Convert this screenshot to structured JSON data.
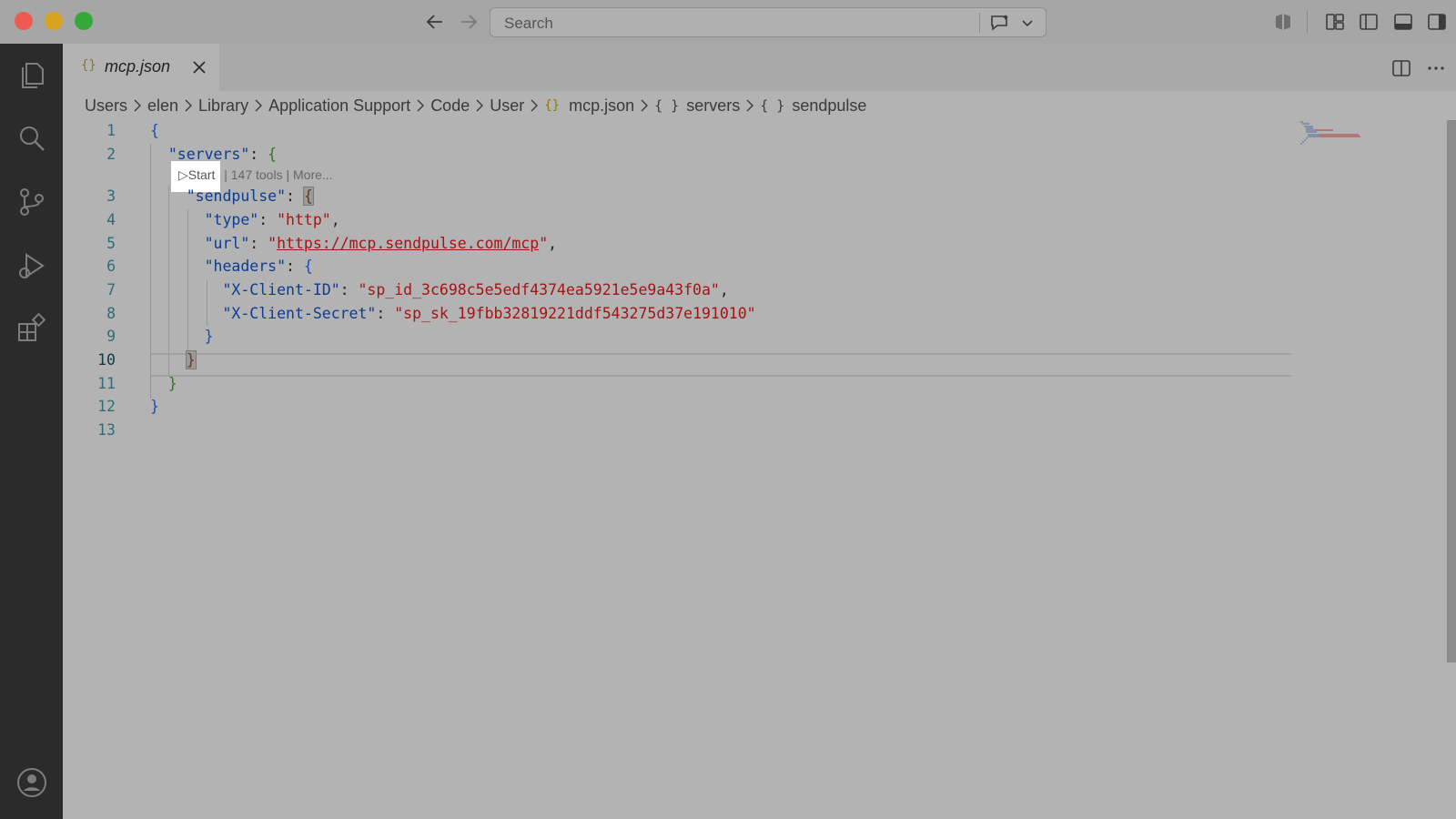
{
  "titlebar": {
    "search_placeholder": "Search",
    "icons": [
      "back-arrow-icon",
      "forward-arrow-icon",
      "chat-icon",
      "chevron-down-icon",
      "copilot-icon",
      "customize-layout-icon",
      "toggle-primary-sidebar-icon",
      "toggle-panel-icon",
      "toggle-secondary-sidebar-icon"
    ]
  },
  "activitybar": {
    "icons": [
      "explorer-icon",
      "search-icon",
      "source-control-icon",
      "run-debug-icon",
      "extensions-icon",
      "account-icon"
    ]
  },
  "tab": {
    "icon": "{}",
    "label": "mcp.json"
  },
  "breadcrumb": {
    "items": [
      "Users",
      "elen",
      "Library",
      "Application Support",
      "Code",
      "User",
      "mcp.json",
      "servers",
      "sendpulse"
    ],
    "json_icon": "{}",
    "obj_icon": "{ }"
  },
  "codelens": {
    "start": "▷Start",
    "rest": " | 147 tools | More..."
  },
  "editor": {
    "line_numbers": [
      "1",
      "2",
      "3",
      "4",
      "5",
      "6",
      "7",
      "8",
      "9",
      "10",
      "11",
      "12",
      "13"
    ],
    "current_line": "10",
    "code": {
      "open_brace": "{",
      "servers_key": "\"servers\"",
      "sendpulse_key": "\"sendpulse\"",
      "type_key": "\"type\"",
      "type_val": "\"http\"",
      "url_key": "\"url\"",
      "url_quote": "\"",
      "url_val": "https://mcp.sendpulse.com/mcp",
      "headers_key": "\"headers\"",
      "client_id_key": "\"X-Client-ID\"",
      "client_id_val": "\"sp_id_3c698c5e5edf4374ea5921e5e9a43f0a\"",
      "client_secret_key": "\"X-Client-Secret\"",
      "client_secret_val": "\"sp_sk_19fbb32819221ddf543275d37e191010\"",
      "close_brace": "}",
      "colon": ": ",
      "comma": ","
    }
  },
  "colors": {
    "close": "#ee5a52",
    "minimize": "#d9a322",
    "maximize": "#35a83a",
    "string": "#a31515",
    "key": "#0c3d8f"
  }
}
